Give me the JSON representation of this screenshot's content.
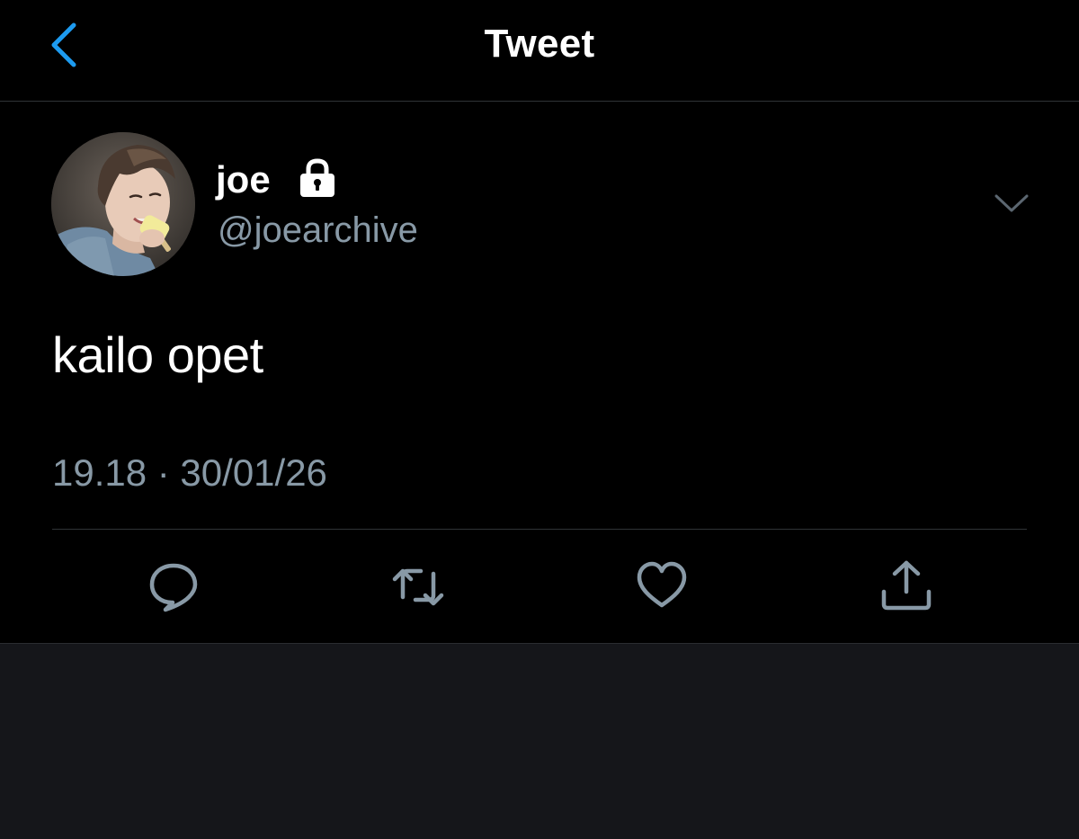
{
  "header": {
    "title": "Tweet",
    "back_icon": "chevron-left-icon"
  },
  "author": {
    "display_name": "joe",
    "handle": "@joearchive",
    "protected_icon": "lock-icon",
    "avatar": "avatar-photo"
  },
  "tweet": {
    "text": "kailo opet",
    "timestamp": "19.18 · 30/01/26"
  },
  "actions": [
    {
      "name": "reply",
      "icon": "reply-icon"
    },
    {
      "name": "retweet",
      "icon": "retweet-icon"
    },
    {
      "name": "like",
      "icon": "heart-icon"
    },
    {
      "name": "share",
      "icon": "share-icon"
    }
  ],
  "colors": {
    "background": "#000000",
    "lower_background": "#15161a",
    "accent": "#1d9bf0",
    "secondary_text": "#8899a6",
    "icon": "#8899a6",
    "divider": "#2f3336"
  }
}
